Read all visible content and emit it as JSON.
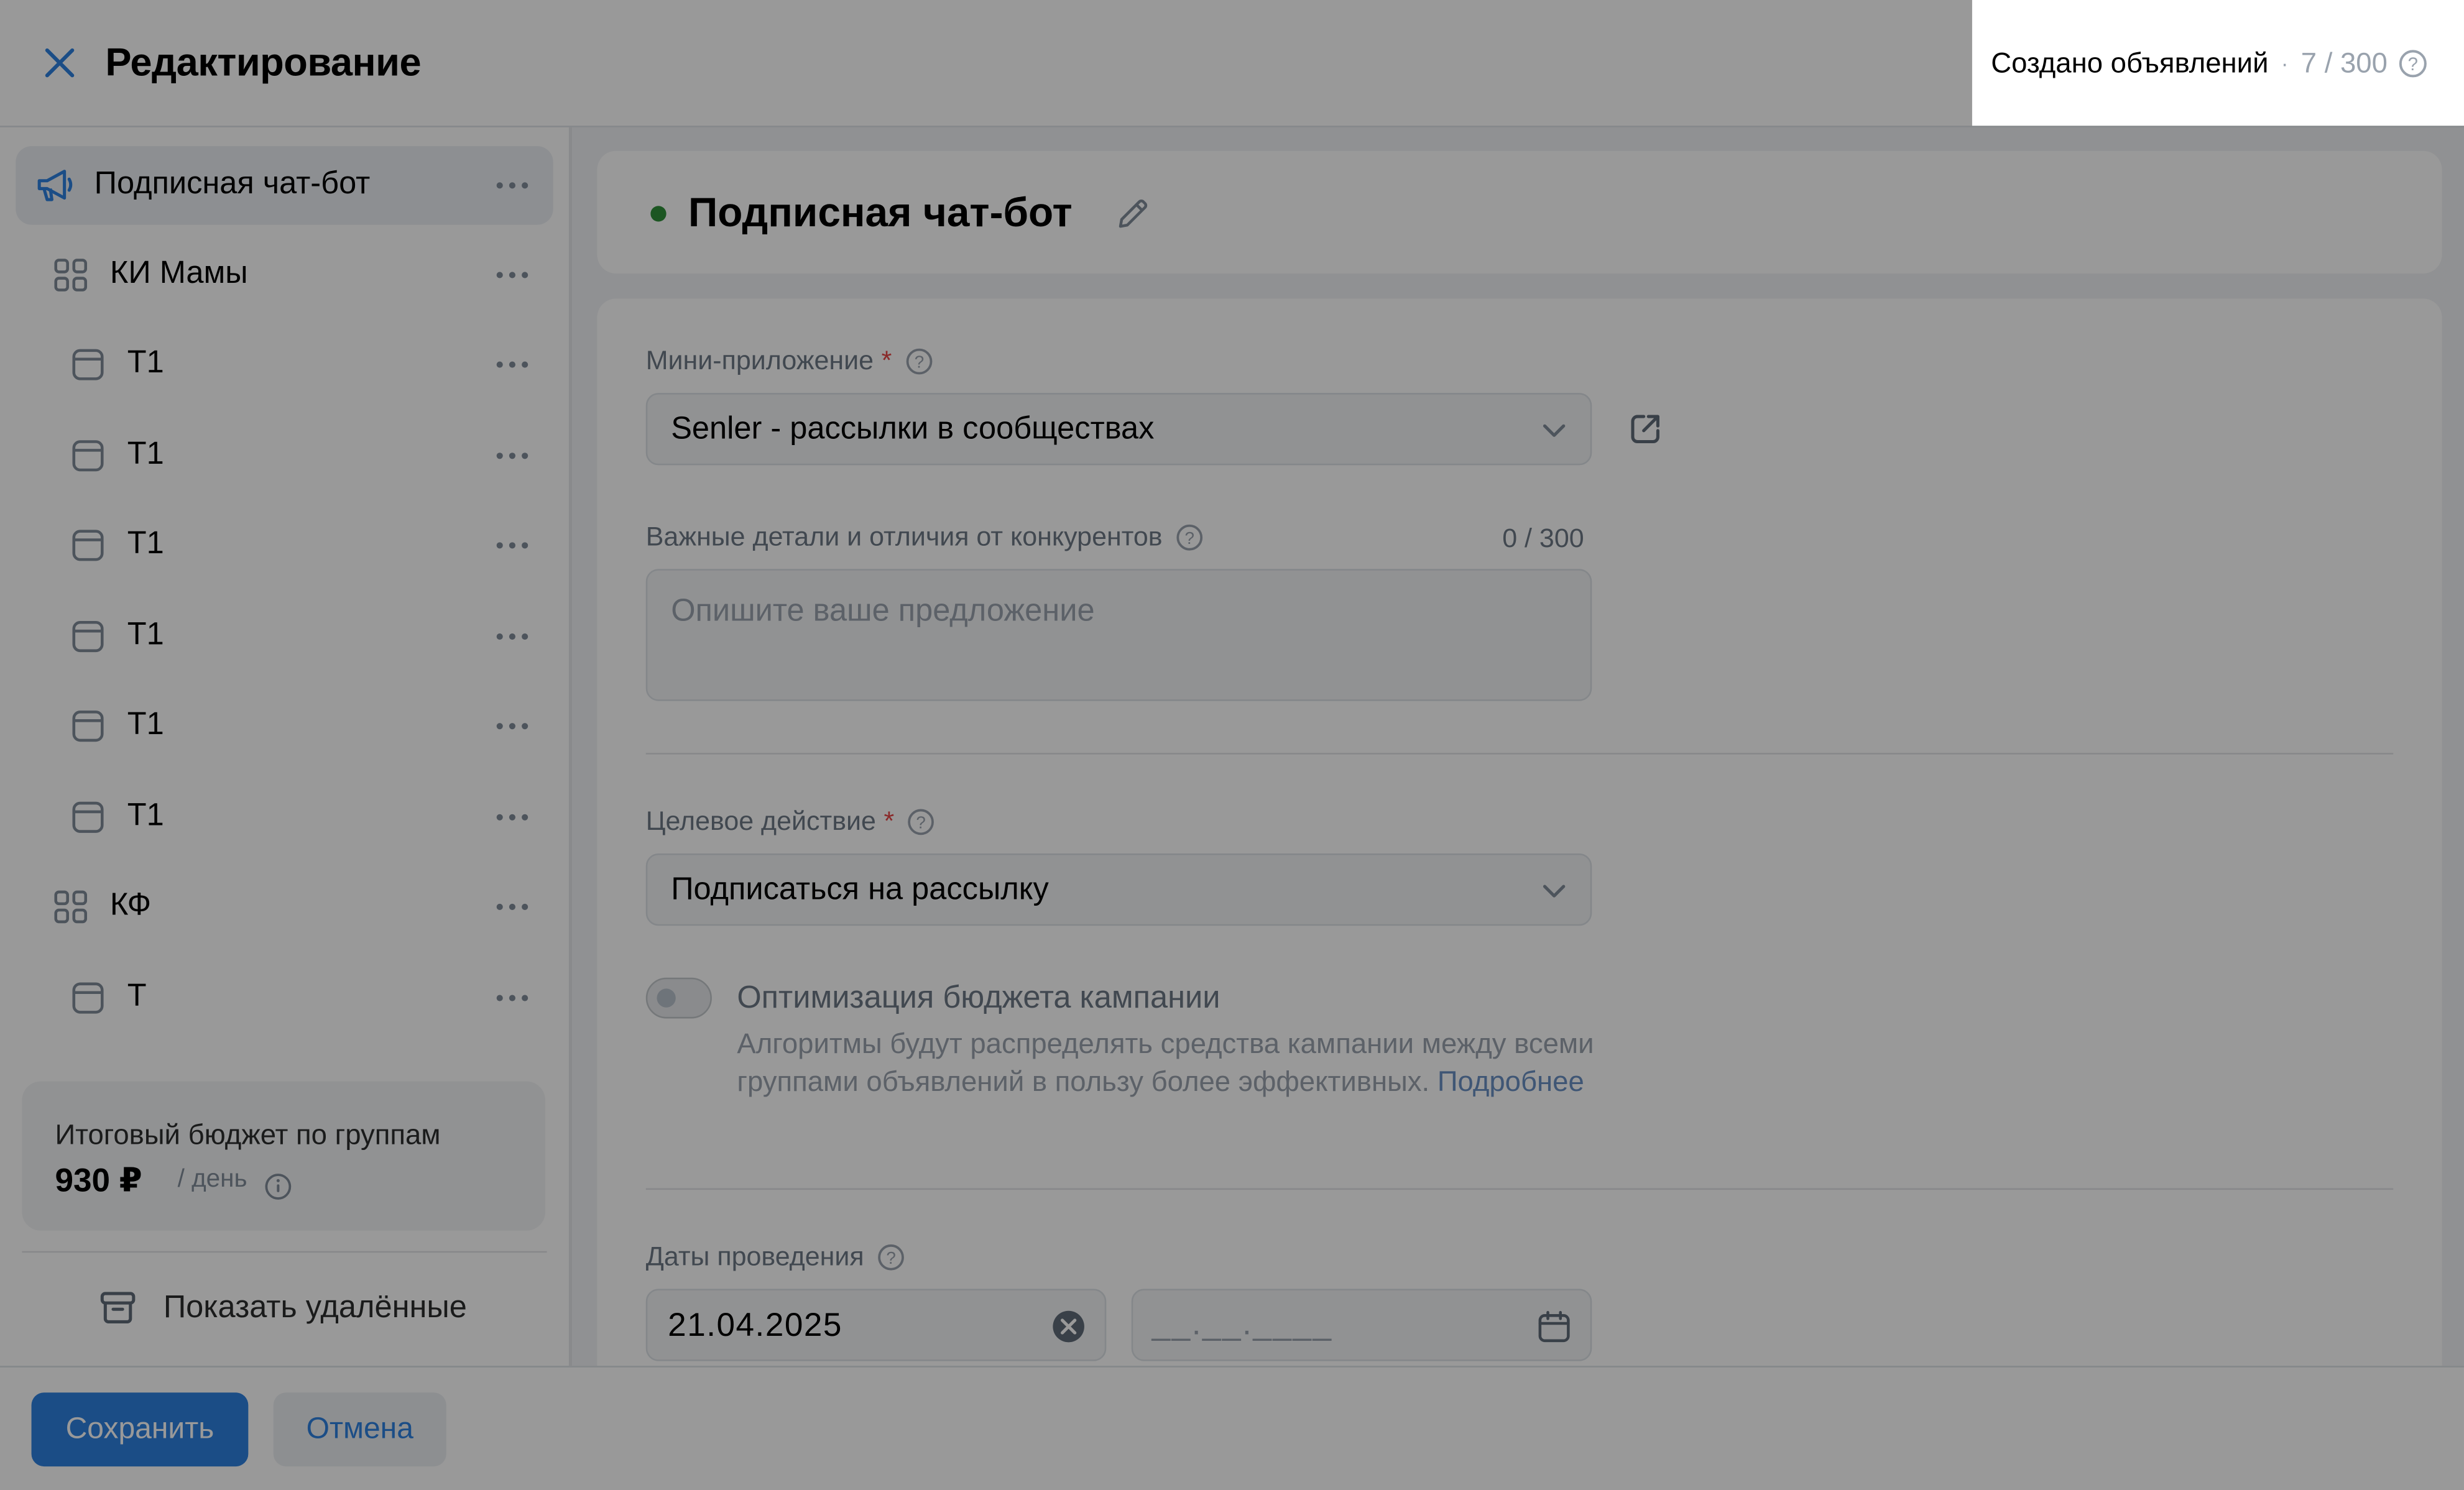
{
  "header": {
    "title": "Редактирование",
    "counter_label": "Создано объявлений",
    "counter_separator": "·",
    "counter_value": "7 / 300"
  },
  "sidebar": {
    "items": [
      {
        "label": "Подписная чат-бот",
        "icon": "megaphone-icon",
        "level": 0,
        "active": true
      },
      {
        "label": "КИ Мамы",
        "icon": "grid-icon",
        "level": 1
      },
      {
        "label": "Т1",
        "icon": "ad-card-icon",
        "level": 2
      },
      {
        "label": "Т1",
        "icon": "ad-card-icon",
        "level": 2
      },
      {
        "label": "Т1",
        "icon": "ad-card-icon",
        "level": 2
      },
      {
        "label": "Т1",
        "icon": "ad-card-icon",
        "level": 2
      },
      {
        "label": "Т1",
        "icon": "ad-card-icon",
        "level": 2
      },
      {
        "label": "Т1",
        "icon": "ad-card-icon",
        "level": 2
      },
      {
        "label": "КФ",
        "icon": "grid-icon",
        "level": 1
      },
      {
        "label": "Т",
        "icon": "ad-card-icon",
        "level": 2
      }
    ],
    "budget_label": "Итоговый бюджет по группам",
    "budget_value": "930 ₽",
    "budget_unit": "/ день",
    "show_deleted_label": "Показать удалённые"
  },
  "campaign": {
    "name": "Подписная чат-бот",
    "status_color": "#2f8f3a"
  },
  "form": {
    "mini_app_label": "Мини-приложение",
    "mini_app_value": "Senler - рассылки в сообществах",
    "details_label": "Важные детали и отличия от конкурентов",
    "details_count": "0 / 300",
    "details_placeholder": "Опишите ваше предложение",
    "target_label": "Целевое действие",
    "target_value": "Подписаться на рассылку",
    "budget_opt_title": "Оптимизация бюджета кампании",
    "budget_opt_desc": "Алгоритмы будут распределять средства кампании между всеми группами объявлений в пользу более эффективных.",
    "budget_opt_link": "Подробнее",
    "budget_opt_enabled": false,
    "dates_label": "Даты проведения",
    "date_start": "21.04.2025",
    "date_end_placeholder": "__.__.____"
  },
  "footer": {
    "save_label": "Сохранить",
    "cancel_label": "Отмена"
  },
  "colors": {
    "accent": "#2d81e0",
    "required": "#e64646",
    "status_active": "#2f8f3a"
  }
}
